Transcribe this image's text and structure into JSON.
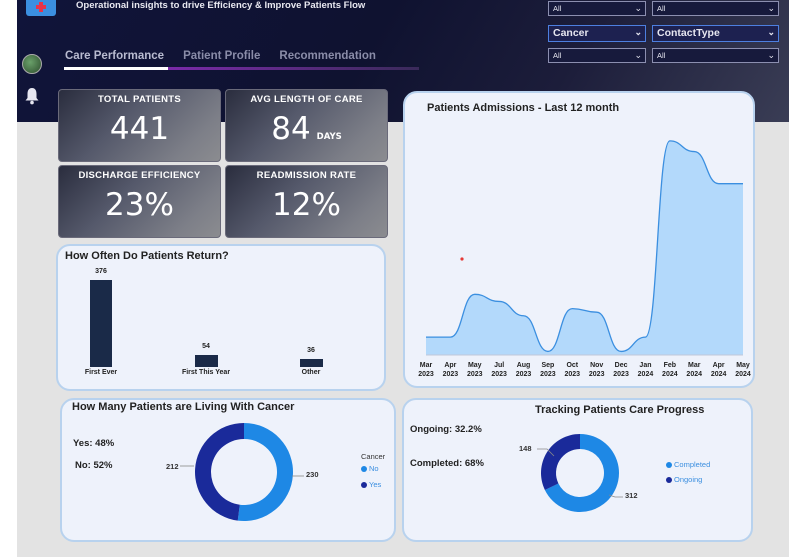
{
  "header": {
    "subtitle": "Operational insights to drive Efficiency & Improve Patients Flow",
    "tabs": [
      {
        "label": "Care Performance",
        "active": true
      },
      {
        "label": "Patient Profile",
        "active": false
      },
      {
        "label": "Recommendation",
        "active": false
      }
    ]
  },
  "filters": {
    "row1": [
      {
        "value": "All"
      },
      {
        "value": "All"
      }
    ],
    "row2": [
      {
        "value": "Cancer"
      },
      {
        "value": "ContactType"
      }
    ],
    "row3": [
      {
        "value": "All"
      },
      {
        "value": "All"
      }
    ]
  },
  "kpis": {
    "total_patients": {
      "label": "TOTAL PATIENTS",
      "value": "441"
    },
    "avg_length": {
      "label": "AVG LENGTH OF CARE",
      "value": "84",
      "unit": "DAYS"
    },
    "discharge": {
      "label": "DISCHARGE EFFICIENCY",
      "value": "23%"
    },
    "readmission": {
      "label": "READMISSION RATE",
      "value": "12%"
    }
  },
  "colors": {
    "accent": "#1e88e5",
    "dark_blue": "#1a2a9a",
    "bar": "#1a2a48",
    "area": "#b3d9fb",
    "line": "#3b8fe0"
  },
  "return_chart": {
    "title": "How Often Do Patients Return?"
  },
  "admissions_chart": {
    "title": "Patients Admissions - Last 12 month"
  },
  "cancer_chart": {
    "title": "How Many Patients are Living With Cancer",
    "yes_text": "Yes: 48%",
    "no_text": "No: 52%",
    "legend_title": "Cancer",
    "legend": [
      "No",
      "Yes"
    ],
    "label_left": "212",
    "label_right": "230"
  },
  "progress_chart": {
    "title": "Tracking Patients Care Progress",
    "ongoing_text": "Ongoing: 32.2%",
    "completed_text": "Completed: 68%",
    "legend": [
      "Completed",
      "Ongoing"
    ],
    "label_left": "148",
    "label_right": "312"
  },
  "chart_data": [
    {
      "type": "bar",
      "title": "How Often Do Patients Return?",
      "categories": [
        "First Ever",
        "First This Year",
        "Other"
      ],
      "values": [
        376,
        54,
        36
      ]
    },
    {
      "type": "area",
      "title": "Patients Admissions - Last 12 month",
      "categories": [
        "Mar 2023",
        "Apr 2023",
        "May 2023",
        "Jul 2023",
        "Aug 2023",
        "Sep 2023",
        "Oct 2023",
        "Nov 2023",
        "Dec 2023",
        "Jan 2024",
        "Feb 2024",
        "Mar 2024",
        "Apr 2024",
        "May 2024"
      ],
      "x_top": [
        "Mar",
        "Apr",
        "May",
        "Jul",
        "Aug",
        "Sep",
        "Oct",
        "Nov",
        "Dec",
        "Jan",
        "Feb",
        "Mar",
        "Apr",
        "May"
      ],
      "x_bottom": [
        "2023",
        "2023",
        "2023",
        "2023",
        "2023",
        "2023",
        "2023",
        "2023",
        "2023",
        "2024",
        "2024",
        "2024",
        "2024",
        "2024"
      ],
      "values": [
        5,
        5,
        17,
        15,
        11,
        1,
        13,
        12,
        1,
        5,
        60,
        57,
        48,
        48
      ],
      "ylim": [
        0,
        65
      ]
    },
    {
      "type": "pie",
      "title": "How Many Patients are Living With Cancer",
      "categories": [
        "No",
        "Yes"
      ],
      "values": [
        230,
        212
      ]
    },
    {
      "type": "pie",
      "title": "Tracking Patients Care Progress",
      "categories": [
        "Completed",
        "Ongoing"
      ],
      "values": [
        312,
        148
      ]
    }
  ]
}
